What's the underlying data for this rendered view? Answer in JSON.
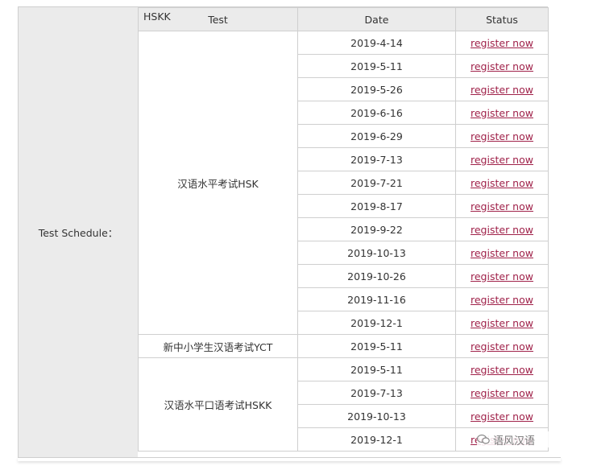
{
  "label": "Test Schedule：",
  "header": {
    "tag": "HSKK",
    "test": "Test",
    "date": "Date",
    "status": "Status"
  },
  "groups": [
    {
      "test": "汉语水平考试HSK",
      "dates": [
        "2019-4-14",
        "2019-5-11",
        "2019-5-26",
        "2019-6-16",
        "2019-6-29",
        "2019-7-13",
        "2019-7-21",
        "2019-8-17",
        "2019-9-22",
        "2019-10-13",
        "2019-10-26",
        "2019-11-16",
        "2019-12-1"
      ]
    },
    {
      "test": "新中小学生汉语考试YCT",
      "dates": [
        "2019-5-11"
      ]
    },
    {
      "test": "汉语水平口语考试HSKK",
      "dates": [
        "2019-5-11",
        "2019-7-13",
        "2019-10-13",
        "2019-12-1"
      ]
    }
  ],
  "status_label": "register now",
  "link_color": "#a0224a",
  "watermark": "语风汉语"
}
